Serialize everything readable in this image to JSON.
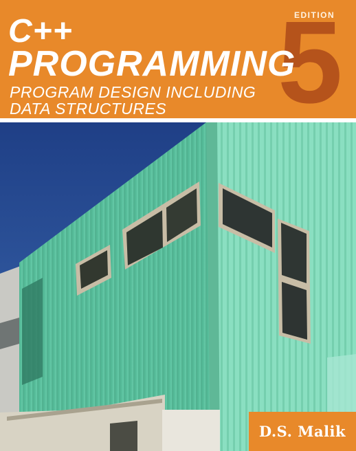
{
  "cover": {
    "title_line1": "C++",
    "title_line2": "PROGRAMMING",
    "subtitle_line1": "PROGRAM DESIGN INCLUDING",
    "subtitle_line2": "DATA STRUCTURES",
    "edition_label": "EDITION",
    "edition_number": "5",
    "author": "D.S. Malik"
  },
  "colors": {
    "header_orange": "#e8892a",
    "edition_number_rust": "#b5531b",
    "building_green": "#63cba8",
    "sky_blue": "#2a4f95"
  }
}
